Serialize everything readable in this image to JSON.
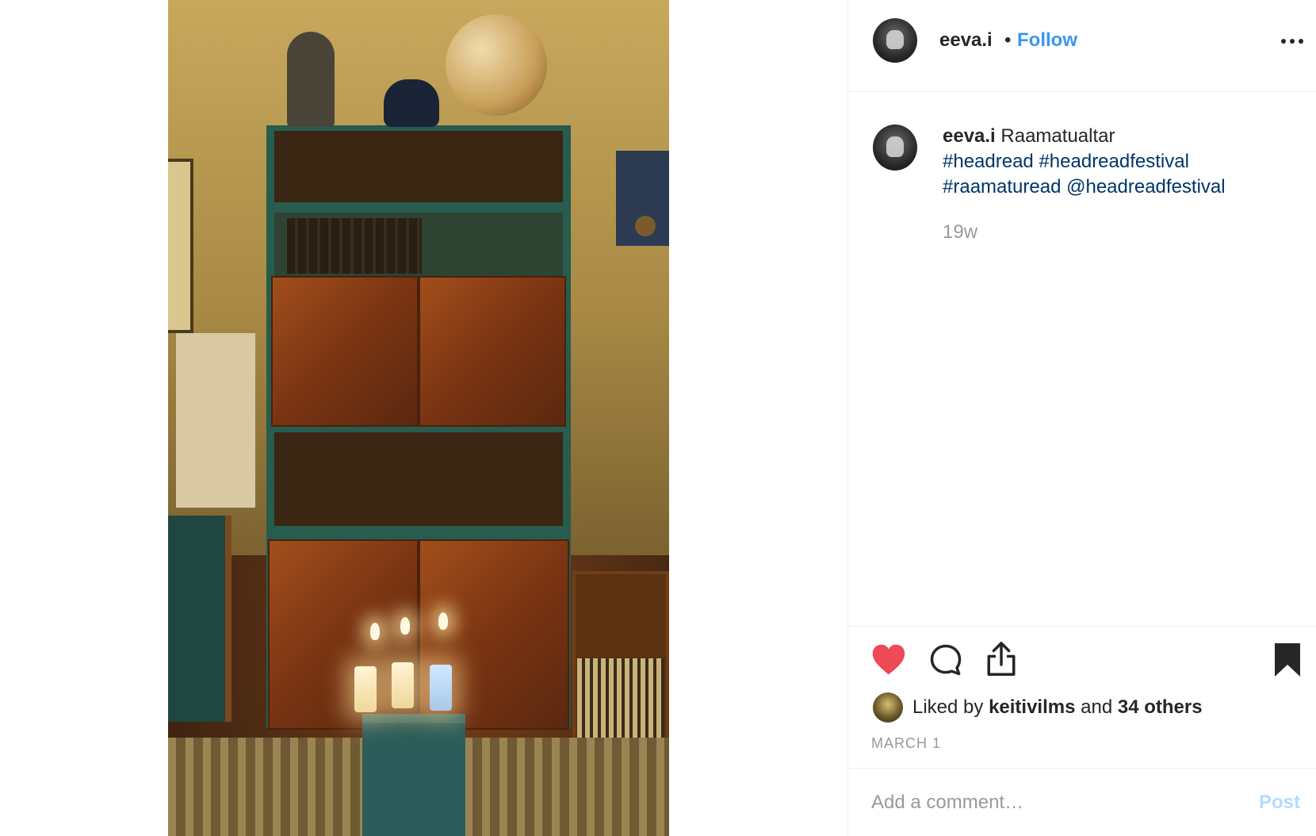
{
  "post": {
    "username": "eeva.i",
    "separator": "•",
    "follow_label": "Follow",
    "caption_text": "Raamatualtar",
    "hashtags": [
      "#headread",
      "#headreadfestival",
      "#raamaturead",
      "@headreadfestival"
    ],
    "time_ago": "19w",
    "date": "MARCH 1"
  },
  "likes": {
    "prefix": "Liked by",
    "user": "keitivilms",
    "connector": "and",
    "others": "34 others"
  },
  "comment": {
    "placeholder": "Add a comment…",
    "post_label": "Post"
  },
  "colors": {
    "follow_blue": "#3897f0",
    "hashtag_blue": "#003569",
    "heart_red": "#ed4956",
    "post_disabled": "#b3dbff",
    "muted_text": "#999999"
  },
  "icons": {
    "more": "more-options-icon",
    "like": "heart-icon",
    "comment": "comment-icon",
    "share": "share-icon",
    "save": "bookmark-icon"
  }
}
